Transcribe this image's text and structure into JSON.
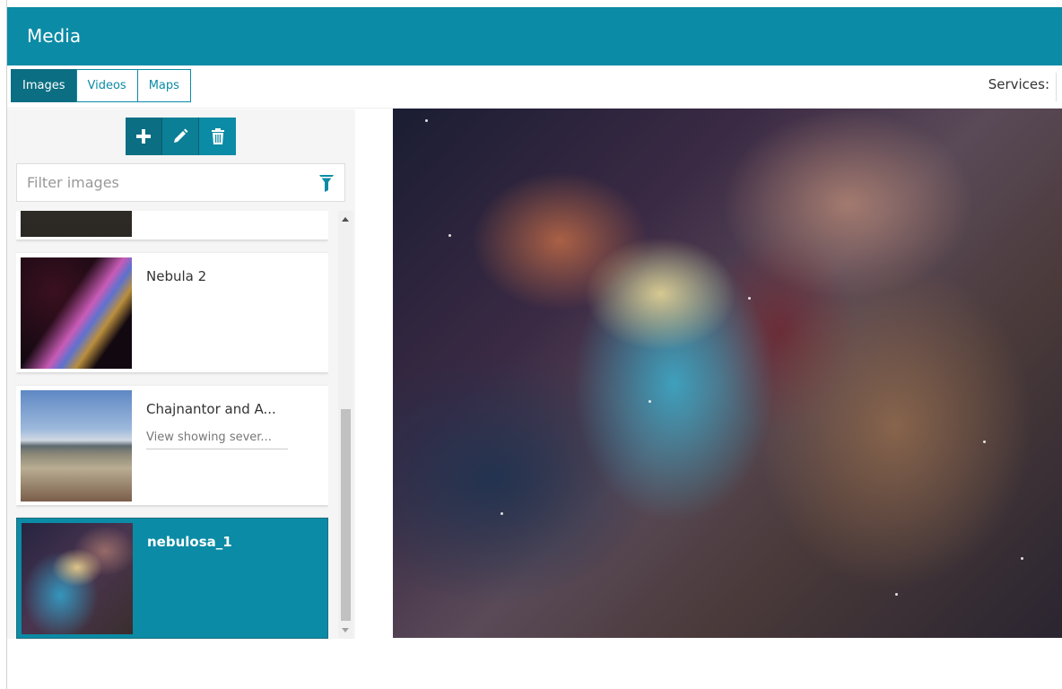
{
  "header": {
    "title": "Media"
  },
  "tabs": [
    {
      "label": "Images",
      "active": true
    },
    {
      "label": "Videos",
      "active": false
    },
    {
      "label": "Maps",
      "active": false
    }
  ],
  "services_label": "Services:",
  "actions": {
    "add_icon": "plus-icon",
    "edit_icon": "pencil-icon",
    "delete_icon": "trash-icon"
  },
  "filter": {
    "placeholder": "Filter images",
    "icon": "funnel-icon"
  },
  "images": [
    {
      "name": "",
      "description": ""
    },
    {
      "name": "Nebula 2",
      "description": ""
    },
    {
      "name": "Chajnantor and A...",
      "description": "View showing sever..."
    },
    {
      "name": "nebulosa_1",
      "description": "",
      "selected": true
    }
  ],
  "colors": {
    "accent": "#0b8ba5",
    "accent_dark": "#0b6e82"
  }
}
